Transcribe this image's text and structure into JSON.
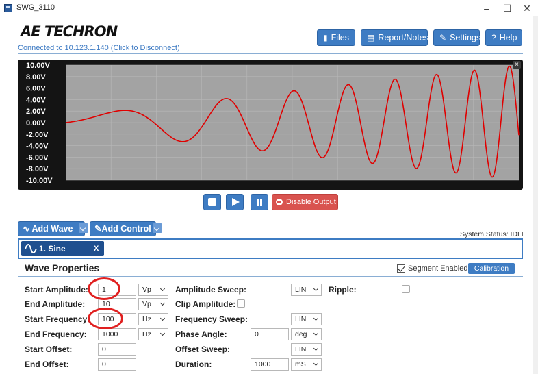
{
  "window": {
    "title": "SWG_3110",
    "minimize": "–",
    "maximize": "☐",
    "close": "✕"
  },
  "header": {
    "logo": "AE TECHRON",
    "connection": "Connected to 10.123.1.140 (Click to Disconnect)",
    "buttons": {
      "files": "Files",
      "report": "Report/Notes",
      "settings": "Settings",
      "help": "Help"
    }
  },
  "scope": {
    "y_ticks": [
      "10.00V",
      "8.00V",
      "6.00V",
      "4.00V",
      "2.00V",
      "0.00V",
      "-2.00V",
      "-4.00V",
      "-6.00V",
      "-8.00V",
      "-10.00V"
    ],
    "close": "×",
    "trace_color": "#e00000",
    "plot_bg": "#a3a3a3",
    "grid_color": "#b8b8b8"
  },
  "transport": {
    "disable_output": "Disable Output"
  },
  "wave_controls": {
    "add_wave": "Add Wave",
    "add_control": "Add Control",
    "system_status": "System Status: IDLE",
    "wave_tab": {
      "label": "1. Sine",
      "close": "X"
    }
  },
  "wave_properties": {
    "title": "Wave Properties",
    "segment_enabled": "Segment Enabled",
    "calibration": "Calibration",
    "rows": {
      "start_amplitude": {
        "label": "Start Amplitude:",
        "value": "1",
        "unit": "Vp"
      },
      "end_amplitude": {
        "label": "End Amplitude:",
        "value": "10",
        "unit": "Vp"
      },
      "start_frequency": {
        "label": "Start Frequency:",
        "value": "100",
        "unit": "Hz"
      },
      "end_frequency": {
        "label": "End Frequency:",
        "value": "1000",
        "unit": "Hz"
      },
      "start_offset": {
        "label": "Start Offset:",
        "value": "0"
      },
      "end_offset": {
        "label": "End Offset:",
        "value": "0"
      }
    },
    "mid": {
      "amplitude_sweep": {
        "label": "Amplitude Sweep:",
        "value": "LIN"
      },
      "clip_amplitude": {
        "label": "Clip Amplitude:"
      },
      "frequency_sweep": {
        "label": "Frequency Sweep:",
        "value": "LIN"
      },
      "phase_angle": {
        "label": "Phase Angle:",
        "value": "0",
        "unit": "deg"
      },
      "offset_sweep": {
        "label": "Offset Sweep:",
        "value": "LIN"
      },
      "duration": {
        "label": "Duration:",
        "value": "1000",
        "unit": "mS"
      }
    },
    "ripple": {
      "label": "Ripple:"
    }
  }
}
